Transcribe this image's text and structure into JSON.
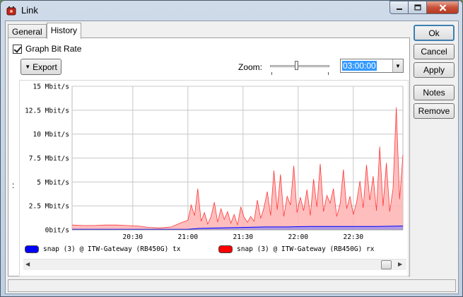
{
  "window": {
    "title": "Link",
    "app_icon": "router-icon"
  },
  "tabs": [
    {
      "label": "General"
    },
    {
      "label": "History"
    }
  ],
  "history": {
    "graph_bit_rate_label": "Graph Bit Rate",
    "graph_bit_rate_checked": true,
    "export_label": "Export",
    "zoom_label": "Zoom:",
    "zoom_value": "03:00:00"
  },
  "buttons": {
    "ok": "Ok",
    "cancel": "Cancel",
    "apply": "Apply",
    "notes": "Notes",
    "remove": "Remove"
  },
  "colors": {
    "tx": "#0000ff",
    "rx": "#ff0000",
    "rx_fill": "#ffb3b3",
    "grid": "#c8c8c8"
  },
  "chart_data": {
    "type": "area",
    "y_tick_labels": [
      "15 Mbit/s",
      "12.5 Mbit/s",
      "10 Mbit/s",
      "7.5 Mbit/s",
      "5 Mbit/s",
      "2.5 Mbit/s",
      "0bit/s"
    ],
    "y_ticks": [
      15,
      12.5,
      10,
      7.5,
      5,
      2.5,
      0
    ],
    "ylim": [
      0,
      15
    ],
    "y_unit": "Mbit/s",
    "x_tick_labels": [
      "20:30",
      "21:00",
      "21:30",
      "22:00",
      "22:30"
    ],
    "x_ticks": [
      20.5,
      21.0,
      21.5,
      22.0,
      22.5
    ],
    "xlim": [
      19.95,
      22.95
    ],
    "grid": true,
    "series": [
      {
        "name": "snap (3) @ ITW-Gateway (RB450G) tx",
        "x": [
          19.95,
          20.2,
          20.5,
          20.8,
          21.0,
          21.1,
          21.3,
          21.5,
          21.7,
          21.9,
          22.1,
          22.3,
          22.5,
          22.7,
          22.95
        ],
        "values": [
          0.05,
          0.05,
          0.05,
          0.05,
          0.05,
          0.15,
          0.2,
          0.25,
          0.3,
          0.3,
          0.35,
          0.35,
          0.35,
          0.35,
          0.4
        ]
      },
      {
        "name": "snap (3) @ ITW-Gateway (RB450G) rx",
        "x": [
          19.95,
          20.05,
          20.15,
          20.25,
          20.35,
          20.45,
          20.55,
          20.65,
          20.75,
          20.85,
          20.95,
          21.0,
          21.03,
          21.06,
          21.09,
          21.12,
          21.15,
          21.18,
          21.21,
          21.24,
          21.27,
          21.3,
          21.33,
          21.36,
          21.39,
          21.42,
          21.45,
          21.48,
          21.51,
          21.54,
          21.57,
          21.6,
          21.63,
          21.66,
          21.69,
          21.72,
          21.75,
          21.78,
          21.81,
          21.84,
          21.87,
          21.9,
          21.93,
          21.96,
          21.99,
          22.02,
          22.05,
          22.08,
          22.11,
          22.14,
          22.17,
          22.2,
          22.23,
          22.26,
          22.29,
          22.32,
          22.35,
          22.38,
          22.41,
          22.44,
          22.47,
          22.5,
          22.53,
          22.56,
          22.59,
          22.62,
          22.65,
          22.68,
          22.71,
          22.74,
          22.77,
          22.8,
          22.83,
          22.86,
          22.89,
          22.92,
          22.95
        ],
        "values": [
          0.5,
          0.45,
          0.45,
          0.5,
          0.5,
          0.45,
          0.4,
          0.25,
          0.2,
          0.3,
          0.8,
          1.0,
          2.6,
          1.5,
          4.3,
          0.9,
          1.8,
          0.6,
          1.4,
          2.9,
          0.8,
          2.2,
          1.1,
          1.9,
          0.7,
          1.6,
          0.5,
          2.4,
          1.3,
          0.8,
          1.4,
          0.9,
          3.1,
          1.2,
          2.3,
          4.0,
          1.5,
          6.2,
          2.1,
          5.8,
          1.4,
          3.5,
          2.6,
          6.7,
          1.8,
          3.4,
          2.0,
          4.2,
          1.5,
          5.3,
          2.4,
          6.9,
          1.9,
          3.6,
          2.8,
          4.3,
          1.4,
          2.7,
          6.3,
          2.2,
          3.5,
          1.6,
          2.9,
          5.1,
          2.3,
          6.8,
          3.1,
          5.6,
          2.0,
          8.7,
          2.5,
          7.0,
          1.9,
          4.3,
          12.8,
          3.2,
          7.8
        ]
      }
    ]
  }
}
